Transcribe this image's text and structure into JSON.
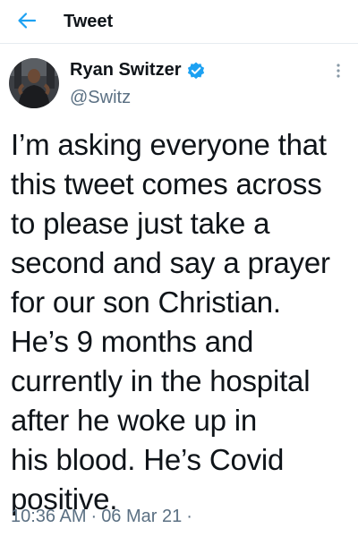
{
  "header": {
    "title": "Tweet",
    "back_icon": "arrow-left-icon",
    "accent_color": "#1da1f2"
  },
  "author": {
    "display_name": "Ryan Switzer",
    "handle": "@Switz",
    "verified_icon": "verified-badge-icon",
    "more_icon": "more-vertical-icon"
  },
  "tweet": {
    "text": "I’m asking everyone that\nthis tweet comes across\nto please just take a\nsecond and say a prayer\nfor our son Christian.\nHe’s 9 months and\ncurrently in the hospital\nafter he woke up in\nhis blood. He’s Covid\npositive.",
    "time": "10:36 AM",
    "date": "06 Mar 21",
    "separator": "·",
    "trailing_separator": "·"
  }
}
